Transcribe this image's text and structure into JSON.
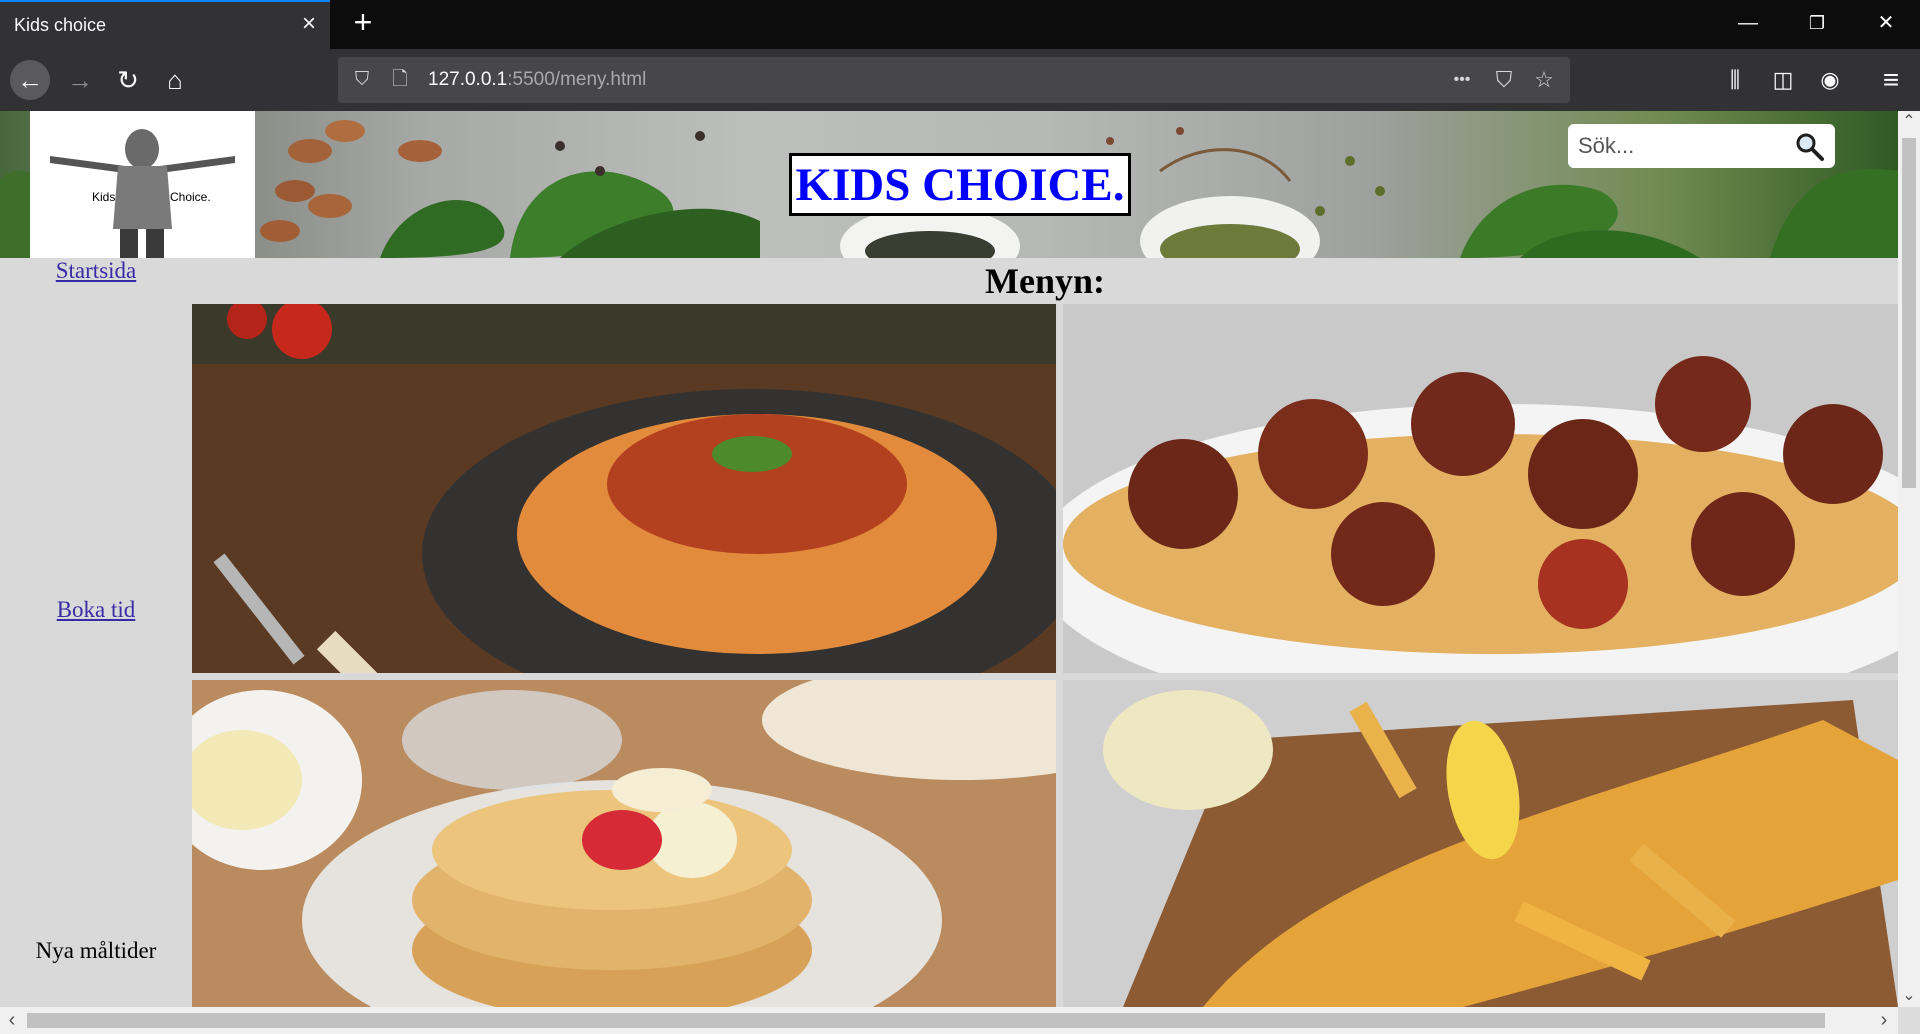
{
  "browser": {
    "tab_title": "Kids choice",
    "tab_close_icon": "×",
    "new_tab_icon": "+",
    "url_host": "127.0.0.1",
    "url_rest": ":5500/meny.html",
    "window_controls": {
      "minimize": "—",
      "restore": "❐",
      "close": "✕"
    },
    "icons": {
      "back": "←",
      "forward": "→",
      "reload": "↻",
      "home": "⌂",
      "shield": "⛉",
      "page": "🗋",
      "more": "•••",
      "pocket": "⛉",
      "bookmark": "☆",
      "library": "⫼",
      "sidebar": "◫",
      "account": "◉",
      "menu": "≡"
    }
  },
  "page": {
    "logo": {
      "left_word": "Kids",
      "right_word": "Choice."
    },
    "title": "KIDS CHOICE.",
    "search": {
      "placeholder": "Sök..."
    },
    "sidebar": {
      "items": [
        {
          "label": "Startsida",
          "link": true
        },
        {
          "label": "Boka tid",
          "link": true
        },
        {
          "label": "Nya måltider",
          "link": false
        }
      ]
    },
    "menu_heading": "Menyn:",
    "dishes": [
      {
        "name": "spaghetti-bolognese"
      },
      {
        "name": "spaghetti-meatballs"
      },
      {
        "name": "pancakes"
      },
      {
        "name": "fish-and-chips"
      }
    ]
  },
  "colors": {
    "title_text": "#0000ff",
    "link": "#3a2aa6",
    "accent_tab": "#0a84ff",
    "page_bg": "#d9d9d9"
  }
}
